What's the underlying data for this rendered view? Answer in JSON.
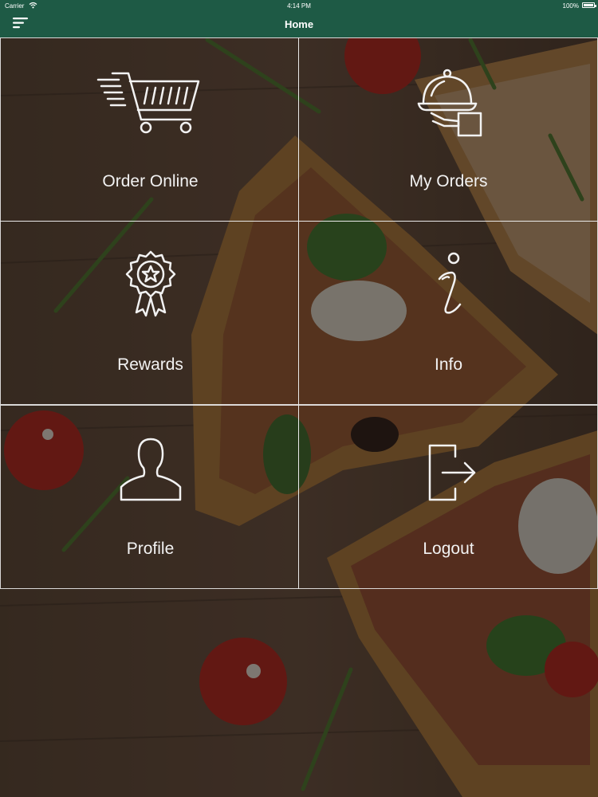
{
  "status_bar": {
    "carrier": "Carrier",
    "time": "4:14 PM",
    "battery": "100%"
  },
  "nav": {
    "title": "Home",
    "menu_icon": "menu-icon"
  },
  "tiles": [
    {
      "label": "Order Online",
      "icon": "shopping-cart-icon"
    },
    {
      "label": "My Orders",
      "icon": "serving-cloche-icon"
    },
    {
      "label": "Rewards",
      "icon": "award-badge-icon"
    },
    {
      "label": "Info",
      "icon": "info-icon"
    },
    {
      "label": "Profile",
      "icon": "user-icon"
    },
    {
      "label": "Logout",
      "icon": "logout-icon"
    }
  ],
  "colors": {
    "header": "#1e5a45",
    "overlay_text": "#f2f2f2",
    "grid_line": "#ebebeb"
  }
}
